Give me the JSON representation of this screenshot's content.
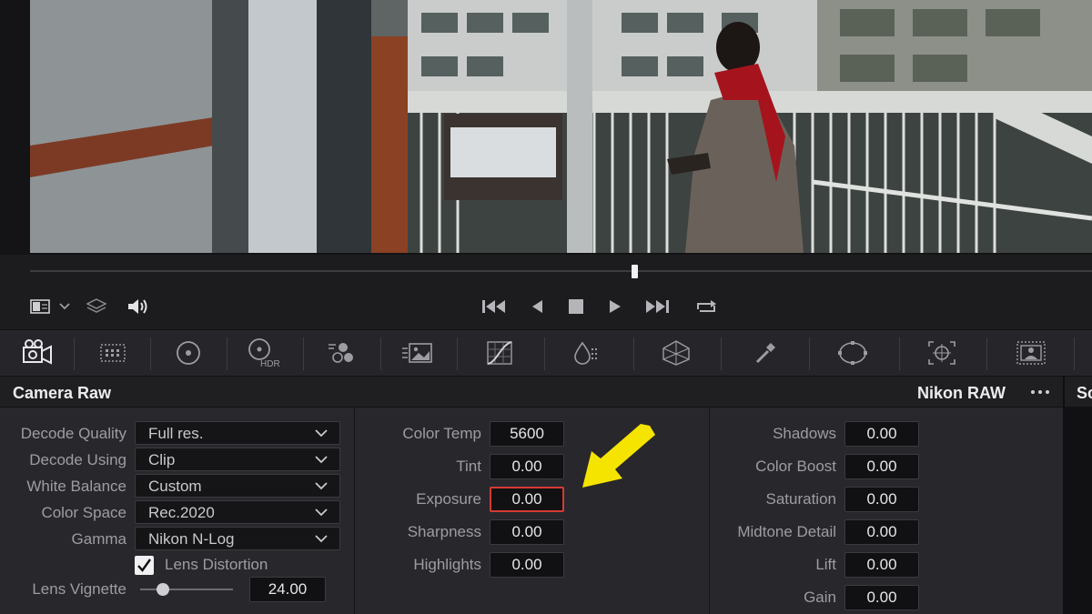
{
  "panel": {
    "title": "Camera Raw",
    "mode": "Nikon RAW",
    "next_panel_cut": "Sc"
  },
  "transport_icons": [
    "clip-view-icon",
    "chevron-down-icon",
    "layers-icon",
    "speaker-icon",
    "skip-to-start-icon",
    "step-back-icon",
    "stop-icon",
    "play-icon",
    "skip-to-end-icon",
    "loop-icon"
  ],
  "palette_icons": [
    "camera-raw-icon",
    "color-match-icon",
    "primaries-wheels-icon",
    "hdr-wheels-icon",
    "rgb-mixer-icon",
    "motion-effects-icon",
    "curves-icon",
    "color-warper-icon",
    "qualifier-icon",
    "window-icon",
    "tracker-icon",
    "magic-mask-icon"
  ],
  "palette_hdr_text": "HDR",
  "left": {
    "rows": [
      {
        "label": "Decode Quality",
        "value": "Full res."
      },
      {
        "label": "Decode Using",
        "value": "Clip"
      },
      {
        "label": "White Balance",
        "value": "Custom"
      },
      {
        "label": "Color Space",
        "value": "Rec.2020"
      },
      {
        "label": "Gamma",
        "value": "Nikon N-Log"
      }
    ],
    "lens_distortion": {
      "label": "Lens Distortion",
      "checked": true
    },
    "lens_vignette": {
      "label": "Lens Vignette",
      "value": "24.00"
    }
  },
  "middle": {
    "color_temp": {
      "label": "Color Temp",
      "value": "5600"
    },
    "tint": {
      "label": "Tint",
      "value": "0.00"
    },
    "exposure": {
      "label": "Exposure",
      "value": "0.00"
    },
    "sharpness": {
      "label": "Sharpness",
      "value": "0.00"
    },
    "highlights": {
      "label": "Highlights",
      "value": "0.00"
    }
  },
  "right": {
    "shadows": {
      "label": "Shadows",
      "value": "0.00"
    },
    "color_boost": {
      "label": "Color Boost",
      "value": "0.00"
    },
    "saturation": {
      "label": "Saturation",
      "value": "0.00"
    },
    "midtone_detail": {
      "label": "Midtone Detail",
      "value": "0.00"
    },
    "lift": {
      "label": "Lift",
      "value": "0.00"
    },
    "gain": {
      "label": "Gain",
      "value": "0.00"
    }
  },
  "colors": {
    "accent_highlight": "#d63a34",
    "annotation_arrow": "#f5e400",
    "scarf": "#a5141c"
  }
}
